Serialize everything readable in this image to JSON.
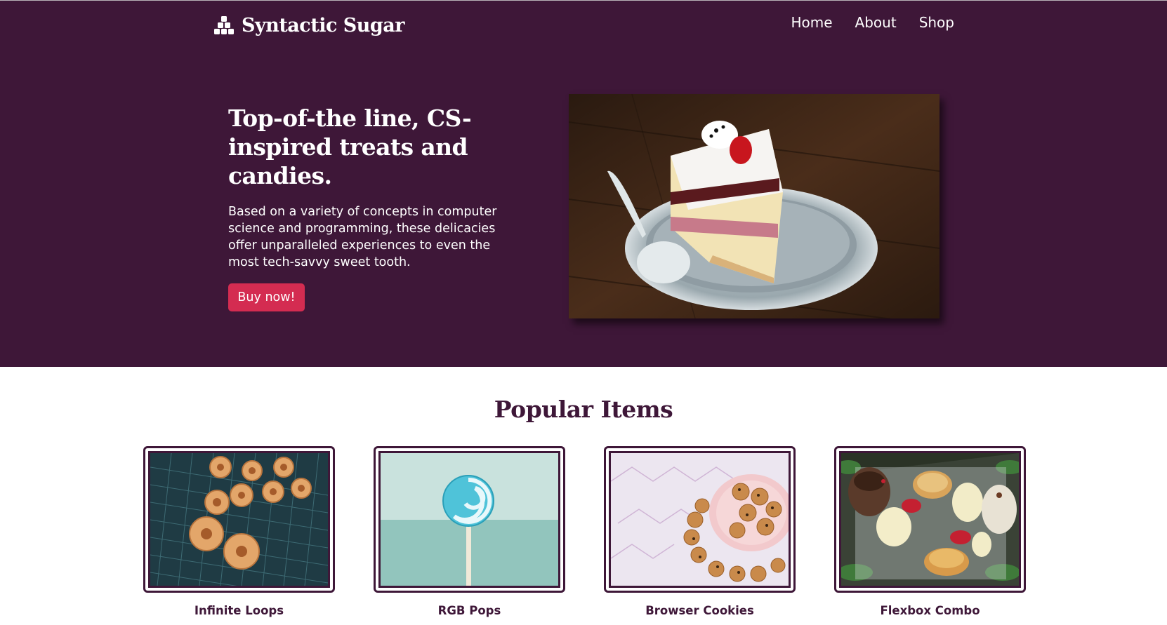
{
  "header": {
    "brand_name": "Syntactic Sugar",
    "brand_icon": "stacked-cubes-icon",
    "nav": [
      "Home",
      "About",
      "Shop"
    ]
  },
  "hero": {
    "title": "Top-of-the line, CS-inspired treats and candies.",
    "description": "Based on a variety of concepts in computer science and programming, these delicacies offer unparalleled experiences to even the most tech-savvy sweet tooth.",
    "button_label": "Buy now!",
    "image": "cake-slice-with-strawberry"
  },
  "popular": {
    "title": "Popular Items",
    "items": [
      {
        "label": "Infinite Loops",
        "image": "mini-donuts-on-cooling-rack"
      },
      {
        "label": "RGB Pops",
        "image": "blue-swirl-lollipop"
      },
      {
        "label": "Browser Cookies",
        "image": "chocolate-chip-cookies-plate"
      },
      {
        "label": "Flexbox Combo",
        "image": "dessert-assortment-box"
      }
    ]
  },
  "colors": {
    "brand_purple": "#3e1738",
    "button_red": "#d42c51",
    "text_white": "#ffffff"
  }
}
